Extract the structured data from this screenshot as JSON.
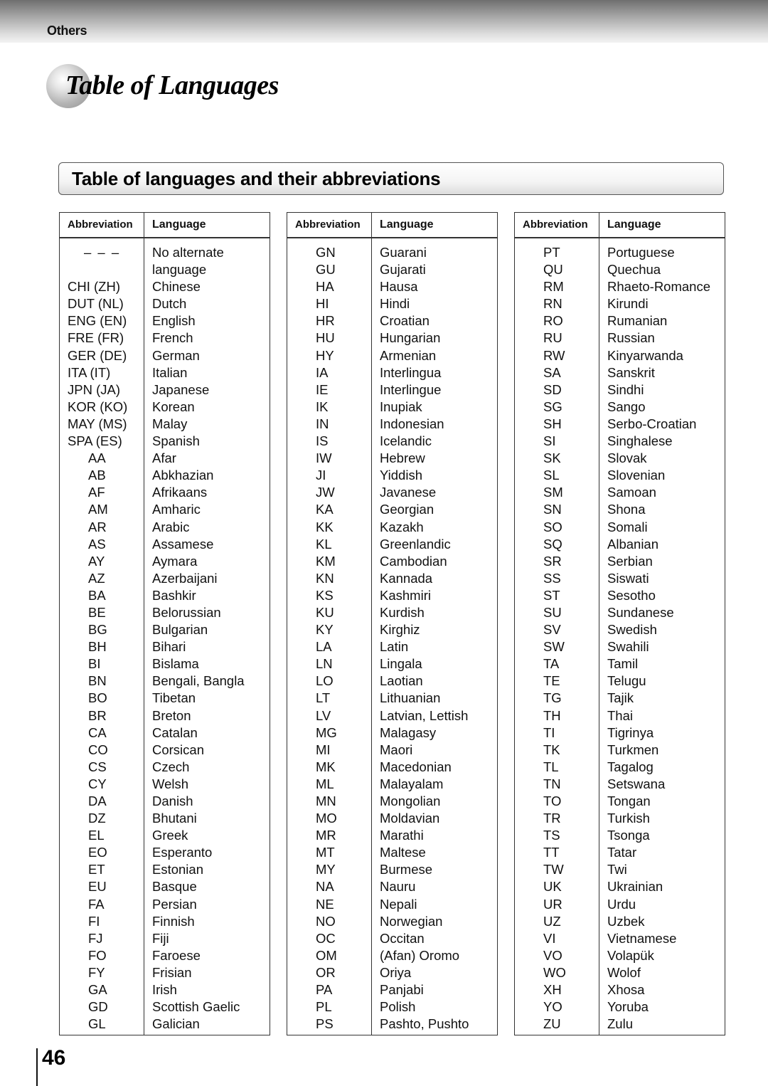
{
  "header": {
    "section_label": "Others",
    "page_title": "Table of Languages"
  },
  "subheading": "Table of languages and their abbreviations",
  "table_headers": {
    "abbreviation": "Abbreviation",
    "language": "Language"
  },
  "tables": [
    {
      "rows": [
        {
          "abbr": "– – –",
          "lang": "No alternate"
        },
        {
          "abbr": "",
          "lang": "language"
        },
        {
          "abbr": "CHI (ZH)",
          "lang": "Chinese"
        },
        {
          "abbr": "DUT (NL)",
          "lang": "Dutch"
        },
        {
          "abbr": "ENG (EN)",
          "lang": "English"
        },
        {
          "abbr": "FRE (FR)",
          "lang": "French"
        },
        {
          "abbr": "GER (DE)",
          "lang": "German"
        },
        {
          "abbr": "ITA (IT)",
          "lang": "Italian"
        },
        {
          "abbr": "JPN (JA)",
          "lang": "Japanese"
        },
        {
          "abbr": "KOR (KO)",
          "lang": "Korean"
        },
        {
          "abbr": "MAY (MS)",
          "lang": "Malay"
        },
        {
          "abbr": "SPA (ES)",
          "lang": "Spanish"
        },
        {
          "abbr": "AA",
          "lang": "Afar"
        },
        {
          "abbr": "AB",
          "lang": "Abkhazian"
        },
        {
          "abbr": "AF",
          "lang": "Afrikaans"
        },
        {
          "abbr": "AM",
          "lang": "Amharic"
        },
        {
          "abbr": "AR",
          "lang": "Arabic"
        },
        {
          "abbr": "AS",
          "lang": "Assamese"
        },
        {
          "abbr": "AY",
          "lang": "Aymara"
        },
        {
          "abbr": "AZ",
          "lang": "Azerbaijani"
        },
        {
          "abbr": "BA",
          "lang": "Bashkir"
        },
        {
          "abbr": "BE",
          "lang": "Belorussian"
        },
        {
          "abbr": "BG",
          "lang": "Bulgarian"
        },
        {
          "abbr": "BH",
          "lang": "Bihari"
        },
        {
          "abbr": "BI",
          "lang": "Bislama"
        },
        {
          "abbr": "BN",
          "lang": "Bengali, Bangla"
        },
        {
          "abbr": "BO",
          "lang": "Tibetan"
        },
        {
          "abbr": "BR",
          "lang": "Breton"
        },
        {
          "abbr": "CA",
          "lang": "Catalan"
        },
        {
          "abbr": "CO",
          "lang": "Corsican"
        },
        {
          "abbr": "CS",
          "lang": "Czech"
        },
        {
          "abbr": "CY",
          "lang": "Welsh"
        },
        {
          "abbr": "DA",
          "lang": "Danish"
        },
        {
          "abbr": "DZ",
          "lang": "Bhutani"
        },
        {
          "abbr": "EL",
          "lang": "Greek"
        },
        {
          "abbr": "EO",
          "lang": "Esperanto"
        },
        {
          "abbr": "ET",
          "lang": "Estonian"
        },
        {
          "abbr": "EU",
          "lang": "Basque"
        },
        {
          "abbr": "FA",
          "lang": "Persian"
        },
        {
          "abbr": "FI",
          "lang": "Finnish"
        },
        {
          "abbr": "FJ",
          "lang": "Fiji"
        },
        {
          "abbr": "FO",
          "lang": "Faroese"
        },
        {
          "abbr": "FY",
          "lang": "Frisian"
        },
        {
          "abbr": "GA",
          "lang": "Irish"
        },
        {
          "abbr": "GD",
          "lang": "Scottish Gaelic"
        },
        {
          "abbr": "GL",
          "lang": "Galician"
        }
      ]
    },
    {
      "rows": [
        {
          "abbr": "GN",
          "lang": "Guarani"
        },
        {
          "abbr": "GU",
          "lang": "Gujarati"
        },
        {
          "abbr": "HA",
          "lang": "Hausa"
        },
        {
          "abbr": "HI",
          "lang": "Hindi"
        },
        {
          "abbr": "HR",
          "lang": "Croatian"
        },
        {
          "abbr": "HU",
          "lang": "Hungarian"
        },
        {
          "abbr": "HY",
          "lang": "Armenian"
        },
        {
          "abbr": "IA",
          "lang": "Interlingua"
        },
        {
          "abbr": "IE",
          "lang": "Interlingue"
        },
        {
          "abbr": "IK",
          "lang": "Inupiak"
        },
        {
          "abbr": "IN",
          "lang": "Indonesian"
        },
        {
          "abbr": "IS",
          "lang": "Icelandic"
        },
        {
          "abbr": "IW",
          "lang": "Hebrew"
        },
        {
          "abbr": "JI",
          "lang": "Yiddish"
        },
        {
          "abbr": "JW",
          "lang": "Javanese"
        },
        {
          "abbr": "KA",
          "lang": "Georgian"
        },
        {
          "abbr": "KK",
          "lang": "Kazakh"
        },
        {
          "abbr": "KL",
          "lang": "Greenlandic"
        },
        {
          "abbr": "KM",
          "lang": "Cambodian"
        },
        {
          "abbr": "KN",
          "lang": "Kannada"
        },
        {
          "abbr": "KS",
          "lang": "Kashmiri"
        },
        {
          "abbr": "KU",
          "lang": "Kurdish"
        },
        {
          "abbr": "KY",
          "lang": "Kirghiz"
        },
        {
          "abbr": "LA",
          "lang": "Latin"
        },
        {
          "abbr": "LN",
          "lang": "Lingala"
        },
        {
          "abbr": "LO",
          "lang": "Laotian"
        },
        {
          "abbr": "LT",
          "lang": "Lithuanian"
        },
        {
          "abbr": "LV",
          "lang": "Latvian, Lettish"
        },
        {
          "abbr": "MG",
          "lang": "Malagasy"
        },
        {
          "abbr": "MI",
          "lang": "Maori"
        },
        {
          "abbr": "MK",
          "lang": "Macedonian"
        },
        {
          "abbr": "ML",
          "lang": "Malayalam"
        },
        {
          "abbr": "MN",
          "lang": "Mongolian"
        },
        {
          "abbr": "MO",
          "lang": "Moldavian"
        },
        {
          "abbr": "MR",
          "lang": "Marathi"
        },
        {
          "abbr": "MT",
          "lang": "Maltese"
        },
        {
          "abbr": "MY",
          "lang": "Burmese"
        },
        {
          "abbr": "NA",
          "lang": "Nauru"
        },
        {
          "abbr": "NE",
          "lang": "Nepali"
        },
        {
          "abbr": "NO",
          "lang": "Norwegian"
        },
        {
          "abbr": "OC",
          "lang": "Occitan"
        },
        {
          "abbr": "OM",
          "lang": "(Afan) Oromo"
        },
        {
          "abbr": "OR",
          "lang": "Oriya"
        },
        {
          "abbr": "PA",
          "lang": "Panjabi"
        },
        {
          "abbr": "PL",
          "lang": "Polish"
        },
        {
          "abbr": "PS",
          "lang": "Pashto, Pushto"
        }
      ]
    },
    {
      "rows": [
        {
          "abbr": "PT",
          "lang": "Portuguese"
        },
        {
          "abbr": "QU",
          "lang": "Quechua"
        },
        {
          "abbr": "RM",
          "lang": "Rhaeto-Romance"
        },
        {
          "abbr": "RN",
          "lang": "Kirundi"
        },
        {
          "abbr": "RO",
          "lang": "Rumanian"
        },
        {
          "abbr": "RU",
          "lang": "Russian"
        },
        {
          "abbr": "RW",
          "lang": "Kinyarwanda"
        },
        {
          "abbr": "SA",
          "lang": "Sanskrit"
        },
        {
          "abbr": "SD",
          "lang": "Sindhi"
        },
        {
          "abbr": "SG",
          "lang": "Sango"
        },
        {
          "abbr": "SH",
          "lang": "Serbo-Croatian"
        },
        {
          "abbr": "SI",
          "lang": "Singhalese"
        },
        {
          "abbr": "SK",
          "lang": "Slovak"
        },
        {
          "abbr": "SL",
          "lang": "Slovenian"
        },
        {
          "abbr": "SM",
          "lang": "Samoan"
        },
        {
          "abbr": "SN",
          "lang": "Shona"
        },
        {
          "abbr": "SO",
          "lang": "Somali"
        },
        {
          "abbr": "SQ",
          "lang": "Albanian"
        },
        {
          "abbr": "SR",
          "lang": "Serbian"
        },
        {
          "abbr": "SS",
          "lang": "Siswati"
        },
        {
          "abbr": "ST",
          "lang": "Sesotho"
        },
        {
          "abbr": "SU",
          "lang": "Sundanese"
        },
        {
          "abbr": "SV",
          "lang": "Swedish"
        },
        {
          "abbr": "SW",
          "lang": "Swahili"
        },
        {
          "abbr": "TA",
          "lang": "Tamil"
        },
        {
          "abbr": "TE",
          "lang": "Telugu"
        },
        {
          "abbr": "TG",
          "lang": "Tajik"
        },
        {
          "abbr": "TH",
          "lang": "Thai"
        },
        {
          "abbr": "TI",
          "lang": "Tigrinya"
        },
        {
          "abbr": "TK",
          "lang": "Turkmen"
        },
        {
          "abbr": "TL",
          "lang": "Tagalog"
        },
        {
          "abbr": "TN",
          "lang": "Setswana"
        },
        {
          "abbr": "TO",
          "lang": "Tongan"
        },
        {
          "abbr": "TR",
          "lang": "Turkish"
        },
        {
          "abbr": "TS",
          "lang": "Tsonga"
        },
        {
          "abbr": "TT",
          "lang": "Tatar"
        },
        {
          "abbr": "TW",
          "lang": "Twi"
        },
        {
          "abbr": "UK",
          "lang": "Ukrainian"
        },
        {
          "abbr": "UR",
          "lang": "Urdu"
        },
        {
          "abbr": "UZ",
          "lang": "Uzbek"
        },
        {
          "abbr": "VI",
          "lang": "Vietnamese"
        },
        {
          "abbr": "VO",
          "lang": "Volapük"
        },
        {
          "abbr": "WO",
          "lang": "Wolof"
        },
        {
          "abbr": "XH",
          "lang": "Xhosa"
        },
        {
          "abbr": "YO",
          "lang": "Yoruba"
        },
        {
          "abbr": "ZU",
          "lang": "Zulu"
        }
      ]
    }
  ],
  "footer": {
    "page_number": "46"
  }
}
